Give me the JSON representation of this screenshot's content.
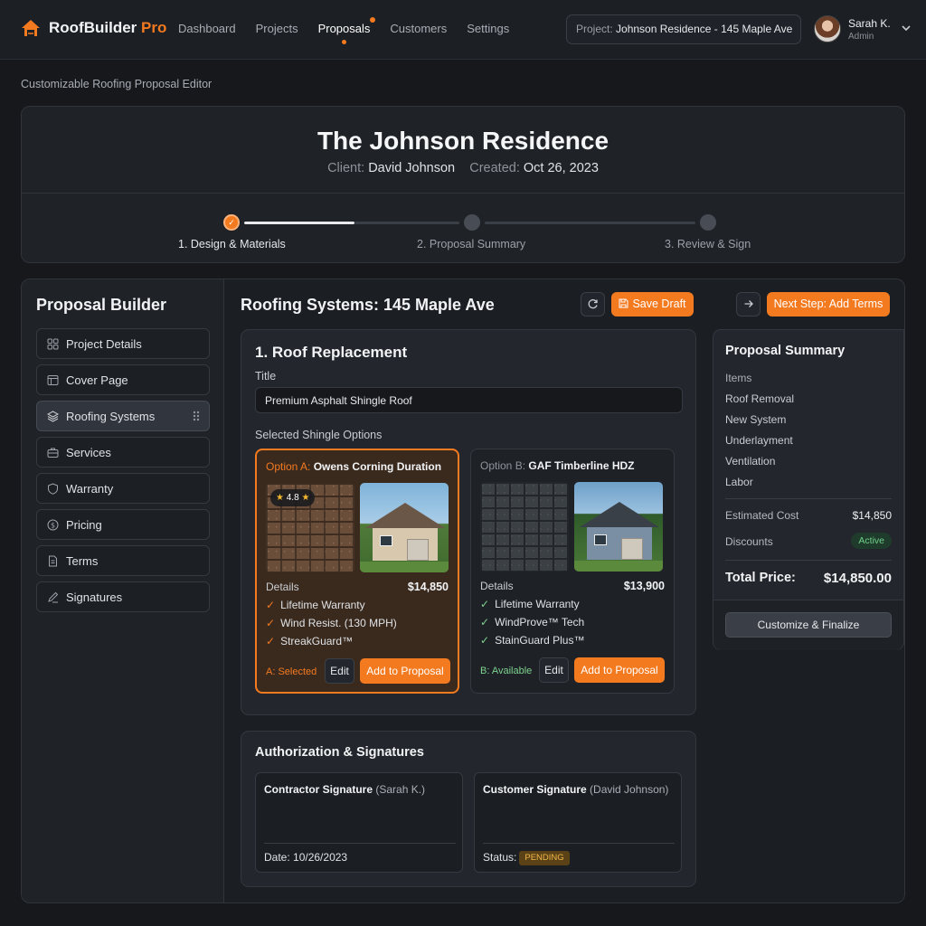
{
  "app": {
    "name": "RoofBuilder",
    "name_accent": "Pro"
  },
  "nav": [
    {
      "label": "Dashboard"
    },
    {
      "label": "Projects"
    },
    {
      "label": "Proposals"
    },
    {
      "label": "Customers"
    },
    {
      "label": "Settings"
    }
  ],
  "project": {
    "prefix": "Project:",
    "value": "Johnson Residence - 145 Maple Ave"
  },
  "user": {
    "name": "Sarah K.",
    "role": "Admin"
  },
  "page_label": "Customizable Roofing Proposal Editor",
  "header": {
    "title": "The Johnson Residence",
    "client_label": "Client:",
    "client_value": "David Johnson",
    "created_label": "Created:",
    "created_value": "Oct 26, 2023"
  },
  "steps": [
    {
      "label": "1. Design & Materials"
    },
    {
      "label": "2. Proposal Summary"
    },
    {
      "label": "3. Review & Sign"
    }
  ],
  "sidebar": {
    "title": "Proposal Builder",
    "items": [
      {
        "label": "Project Details",
        "icon": "grid-icon"
      },
      {
        "label": "Cover Page",
        "icon": "layout-icon"
      },
      {
        "label": "Roofing Systems",
        "icon": "layers-icon"
      },
      {
        "label": "Services",
        "icon": "briefcase-icon"
      },
      {
        "label": "Warranty",
        "icon": "shield-icon"
      },
      {
        "label": "Pricing",
        "icon": "dollar-icon"
      },
      {
        "label": "Terms",
        "icon": "document-icon"
      },
      {
        "label": "Signatures",
        "icon": "pen-icon"
      }
    ]
  },
  "main": {
    "title": "Roofing Systems: 145 Maple Ave",
    "save_draft": "Save Draft",
    "next_step": "Next Step: Add Terms"
  },
  "roof": {
    "title": "1. Roof Replacement",
    "title_label": "Title",
    "title_value": "Premium Asphalt Shingle Roof",
    "options_label": "Selected Shingle Options",
    "options": [
      {
        "prefix": "Option A:",
        "name": "Owens Corning Duration",
        "rating": "4.8",
        "details_label": "Details",
        "price": "$14,850",
        "features": [
          "Lifetime Warranty",
          "Wind Resist. (130 MPH)",
          "StreakGuard™"
        ],
        "status": "A: Selected",
        "edit": "Edit",
        "add": "Add to Proposal"
      },
      {
        "prefix": "Option B:",
        "name": "GAF Timberline HDZ",
        "details_label": "Details",
        "price": "$13,900",
        "features": [
          "Lifetime Warranty",
          "WindProve™ Tech",
          "StainGuard Plus™"
        ],
        "status": "B: Available",
        "edit": "Edit",
        "add": "Add to Proposal"
      }
    ]
  },
  "summary": {
    "title": "Proposal Summary",
    "items_label": "Items",
    "items": [
      "Roof Removal",
      "New System",
      "Underlayment",
      "Ventilation",
      "Labor"
    ],
    "estimated_label": "Estimated Cost",
    "estimated_value": "$14,850",
    "discounts_label": "Discounts",
    "discounts_status": "Active",
    "total_label": "Total Price:",
    "total_value": "$14,850.00",
    "finalize": "Customize & Finalize"
  },
  "auth": {
    "title": "Authorization & Signatures",
    "contractor_label": "Contractor Signature",
    "contractor_who": "(Sarah K.)",
    "contractor_date_label": "Date:",
    "contractor_date": "10/26/2023",
    "customer_label": "Customer Signature",
    "customer_who": "(David Johnson)",
    "customer_status_label": "Status:",
    "customer_status": "PENDING"
  },
  "colors": {
    "accent": "#f47a20",
    "success": "#6fd08a",
    "background": "#16181c"
  }
}
